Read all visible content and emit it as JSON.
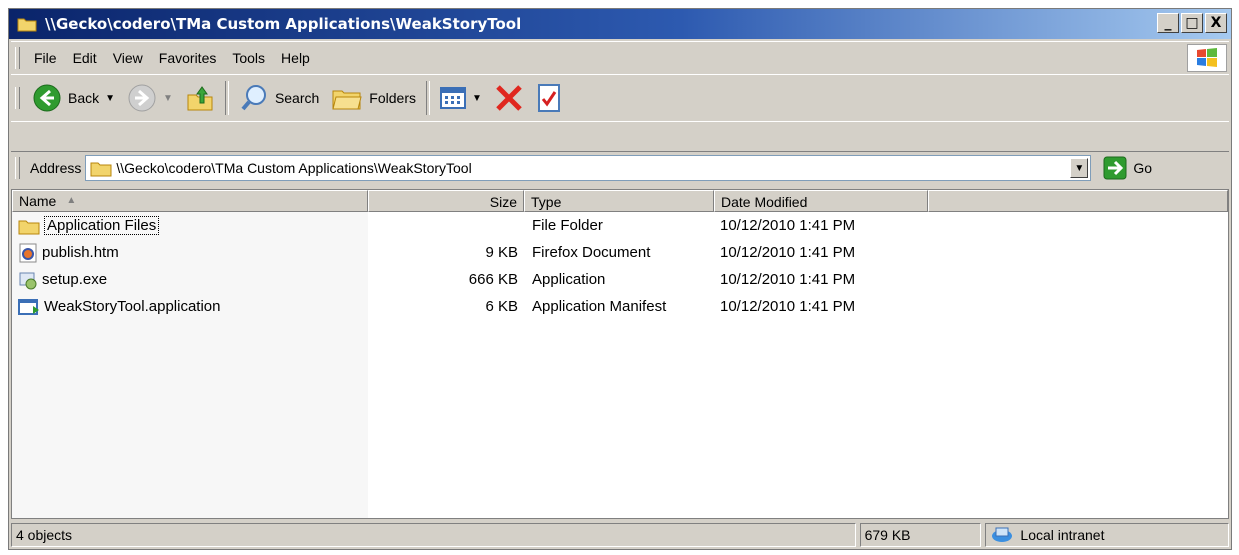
{
  "window": {
    "title": "\\\\Gecko\\codero\\TMa Custom Applications\\WeakStoryTool",
    "controls": {
      "minimize": "_",
      "maximize": "□",
      "close": "X"
    }
  },
  "menu": {
    "items": [
      {
        "label": "File"
      },
      {
        "label": "Edit"
      },
      {
        "label": "View"
      },
      {
        "label": "Favorites"
      },
      {
        "label": "Tools"
      },
      {
        "label": "Help"
      }
    ]
  },
  "toolbar": {
    "back_label": "Back",
    "search_label": "Search",
    "folders_label": "Folders"
  },
  "address": {
    "label": "Address",
    "value": "\\\\Gecko\\codero\\TMa Custom Applications\\WeakStoryTool",
    "go_label": "Go"
  },
  "list": {
    "columns": [
      "Name",
      "Size",
      "Type",
      "Date Modified"
    ],
    "sort_indicator": "▲",
    "rows": [
      {
        "name": "Application Files",
        "size": "",
        "type": "File Folder",
        "date": "10/12/2010 1:41 PM",
        "icon": "folder-icon"
      },
      {
        "name": "publish.htm",
        "size": "9 KB",
        "type": "Firefox Document",
        "date": "10/12/2010 1:41 PM",
        "icon": "firefox-document-icon"
      },
      {
        "name": "setup.exe",
        "size": "666 KB",
        "type": "Application",
        "date": "10/12/2010 1:41 PM",
        "icon": "setup-exe-icon"
      },
      {
        "name": "WeakStoryTool.application",
        "size": "6 KB",
        "type": "Application Manifest",
        "date": "10/12/2010 1:41 PM",
        "icon": "application-manifest-icon"
      }
    ]
  },
  "status": {
    "objects": "4 objects",
    "size": "679 KB",
    "zone": "Local intranet"
  }
}
